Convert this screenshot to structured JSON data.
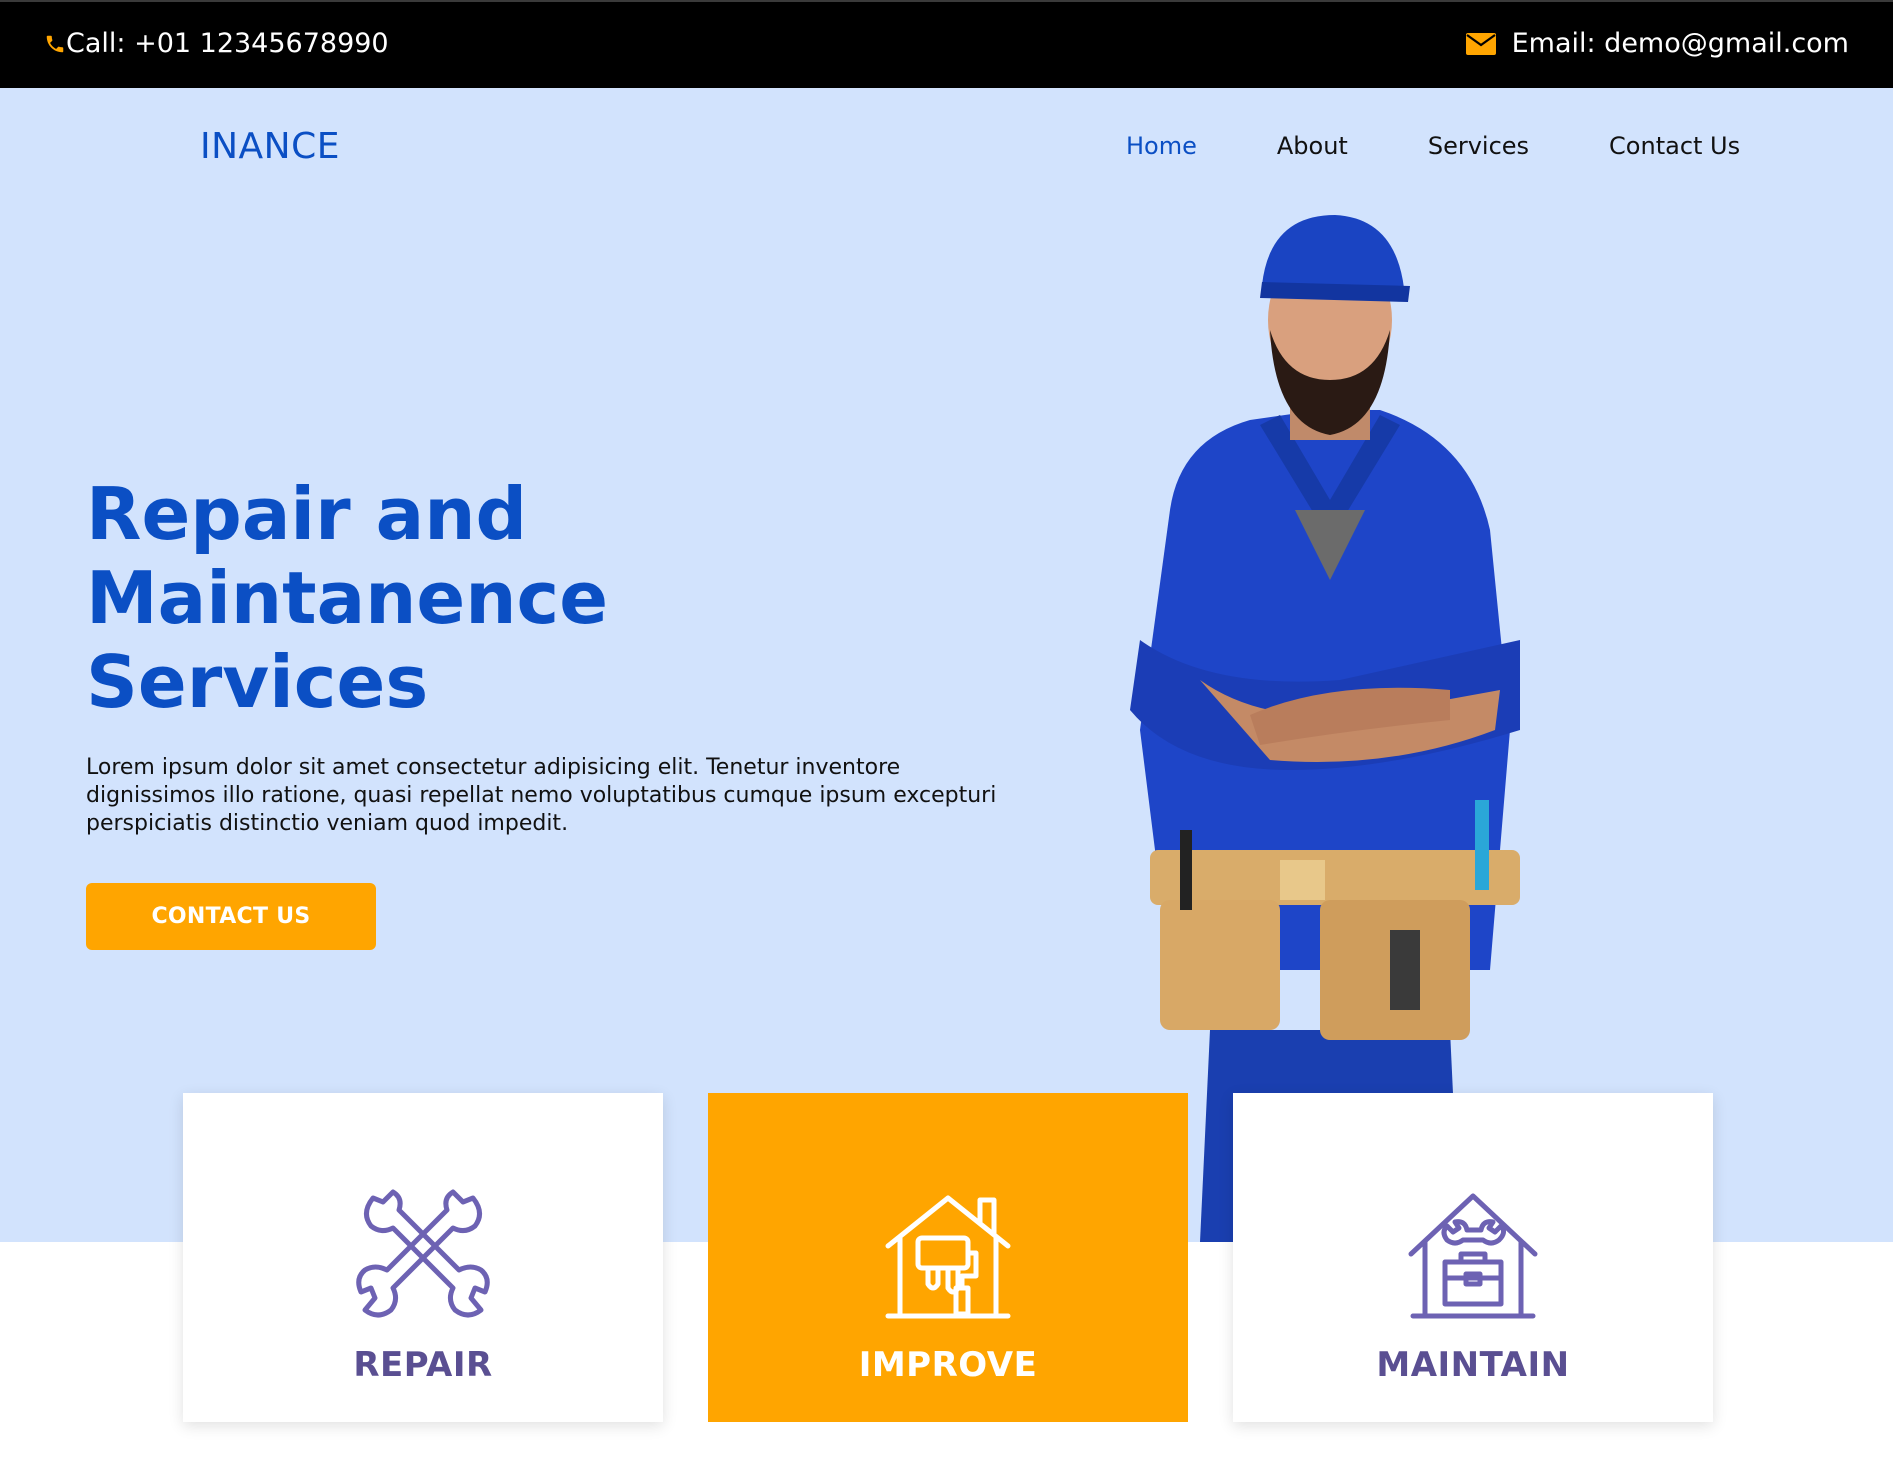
{
  "topbar": {
    "call_text": "Call: +01 12345678990",
    "email_text": "Email: demo@gmail.com",
    "icons": [
      "phone-icon",
      "envelope-icon"
    ],
    "accent_color": "#ffa500"
  },
  "brand": {
    "name": "INANCE"
  },
  "nav": {
    "items": [
      {
        "label": "Home",
        "active": true
      },
      {
        "label": "About",
        "active": false
      },
      {
        "label": "Services",
        "active": false
      },
      {
        "label": "Contact Us",
        "active": false
      }
    ]
  },
  "hero": {
    "title_lines": [
      "Repair and",
      "Maintanence",
      "Services"
    ],
    "description": "Lorem ipsum dolor sit amet consectetur adipisicing elit. Tenetur inventore dignissimos illo ratione, quasi repellat nemo voluptatibus cumque ipsum excepturi perspiciatis distinctio veniam quod impedit.",
    "cta_label": "CONTACT US",
    "background_color": "#d2e3fd",
    "title_color": "#0b4fc4"
  },
  "services": [
    {
      "label": "REPAIR",
      "icon": "crossed-wrenches-icon",
      "highlight": false
    },
    {
      "label": "IMPROVE",
      "icon": "house-paint-roller-icon",
      "highlight": true
    },
    {
      "label": "MAINTAIN",
      "icon": "house-toolbox-icon",
      "highlight": false
    }
  ]
}
